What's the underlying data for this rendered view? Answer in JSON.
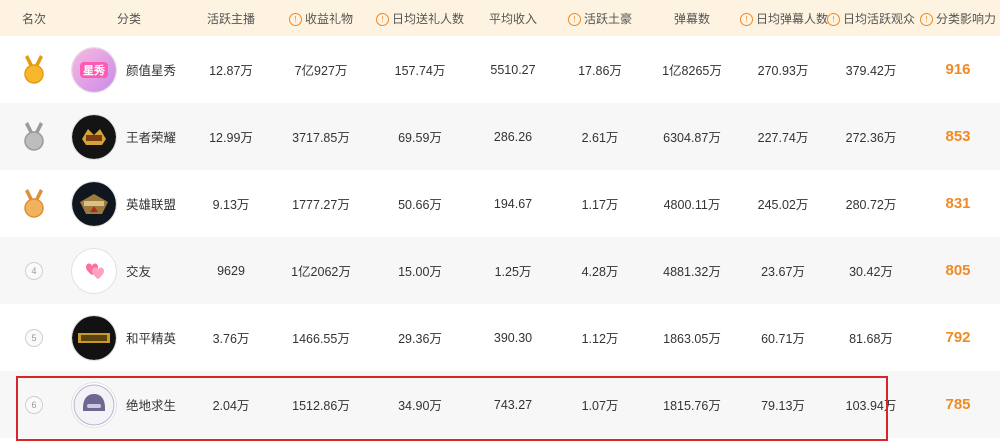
{
  "colors": {
    "accent": "#f08a24",
    "header_bg": "#fdf3e0",
    "highlight_border": "#d9232d"
  },
  "headers": [
    {
      "label": "名次",
      "info": false
    },
    {
      "label": "分类",
      "info": false
    },
    {
      "label": "活跃主播",
      "info": false
    },
    {
      "label": "收益礼物",
      "info": true
    },
    {
      "label": "日均送礼人数",
      "info": true
    },
    {
      "label": "平均收入",
      "info": false
    },
    {
      "label": "活跃土豪",
      "info": true
    },
    {
      "label": "弹幕数",
      "info": false
    },
    {
      "label": "日均弹幕人数",
      "info": true
    },
    {
      "label": "日均活跃观众",
      "info": true
    },
    {
      "label": "分类影响力",
      "info": true
    }
  ],
  "info_glyph": "!",
  "rows": [
    {
      "rank": "1",
      "medal": "gold",
      "category": "颜值星秀",
      "logo_icon": "yanzhi-xingxiu-logo-icon",
      "logo_text": "星秀",
      "active_anchors": "12.87万",
      "gift_income": "7亿927万",
      "daily_gifters": "157.74万",
      "avg_income": "5510.27",
      "active_big_spenders": "17.86万",
      "danmaku": "1亿8265万",
      "daily_danmaku_users": "270.93万",
      "daily_active_viewers": "379.42万",
      "influence": "916"
    },
    {
      "rank": "2",
      "medal": "silver",
      "category": "王者荣耀",
      "logo_icon": "honor-of-kings-logo-icon",
      "logo_text": "",
      "active_anchors": "12.99万",
      "gift_income": "3717.85万",
      "daily_gifters": "69.59万",
      "avg_income": "286.26",
      "active_big_spenders": "2.61万",
      "danmaku": "6304.87万",
      "daily_danmaku_users": "227.74万",
      "daily_active_viewers": "272.36万",
      "influence": "853"
    },
    {
      "rank": "3",
      "medal": "bronze",
      "category": "英雄联盟",
      "logo_icon": "league-of-legends-logo-icon",
      "logo_text": "",
      "active_anchors": "9.13万",
      "gift_income": "1777.27万",
      "daily_gifters": "50.66万",
      "avg_income": "194.67",
      "active_big_spenders": "1.17万",
      "danmaku": "4800.11万",
      "daily_danmaku_users": "245.02万",
      "daily_active_viewers": "280.72万",
      "influence": "831"
    },
    {
      "rank": "4",
      "medal": "",
      "category": "交友",
      "logo_icon": "hearts-logo-icon",
      "logo_text": "",
      "active_anchors": "9629",
      "gift_income": "1亿2062万",
      "daily_gifters": "15.00万",
      "avg_income": "1.25万",
      "active_big_spenders": "4.28万",
      "danmaku": "4881.32万",
      "daily_danmaku_users": "23.67万",
      "daily_active_viewers": "30.42万",
      "influence": "805"
    },
    {
      "rank": "5",
      "medal": "",
      "category": "和平精英",
      "logo_icon": "peace-elite-logo-icon",
      "logo_text": "",
      "active_anchors": "3.76万",
      "gift_income": "1466.55万",
      "daily_gifters": "29.36万",
      "avg_income": "390.30",
      "active_big_spenders": "1.12万",
      "danmaku": "1863.05万",
      "daily_danmaku_users": "60.71万",
      "daily_active_viewers": "81.68万",
      "influence": "792"
    },
    {
      "rank": "6",
      "medal": "",
      "category": "绝地求生",
      "logo_icon": "pubg-helmet-logo-icon",
      "logo_text": "",
      "active_anchors": "2.04万",
      "gift_income": "1512.86万",
      "daily_gifters": "34.90万",
      "avg_income": "743.27",
      "active_big_spenders": "1.07万",
      "danmaku": "1815.76万",
      "daily_danmaku_users": "79.13万",
      "daily_active_viewers": "103.94万",
      "influence": "785"
    }
  ]
}
